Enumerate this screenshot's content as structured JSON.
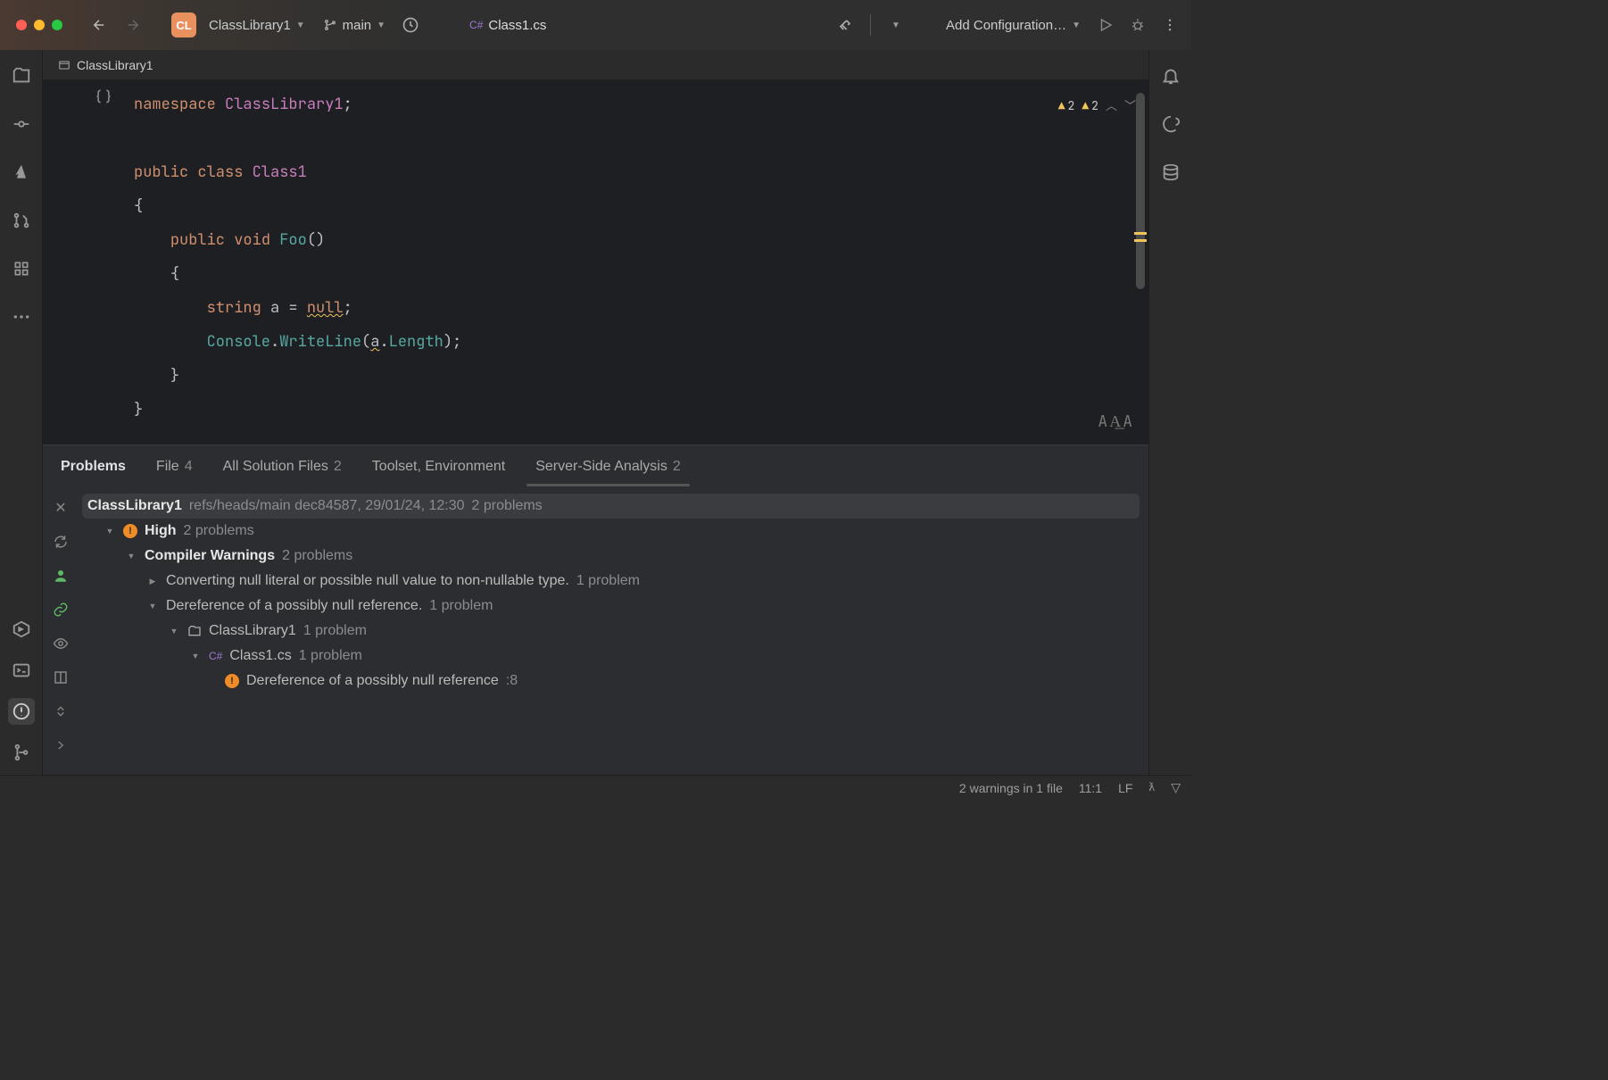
{
  "toolbar": {
    "project_badge": "CL",
    "project_name": "ClassLibrary1",
    "branch": "main",
    "open_file": "Class1.cs",
    "run_config": "Add Configuration…"
  },
  "breadcrumb": {
    "root": "ClassLibrary1"
  },
  "editor": {
    "warnings_a": "2",
    "warnings_b": "2",
    "code": {
      "namespace_kw": "namespace",
      "namespace_name": "ClassLibrary1",
      "semi": ";",
      "public_kw": "public",
      "class_kw": "class",
      "class_name": "Class1",
      "lbrace": "{",
      "void_kw": "void",
      "method_name": "Foo",
      "parens": "()",
      "string_kw": "string",
      "var_a": "a",
      "eq": "=",
      "null_kw": "null",
      "console": "Console",
      "dot": ".",
      "writeline": "WriteLine",
      "open_p": "(",
      "length": "Length",
      "close_p": ")",
      "rbrace": "}"
    }
  },
  "problems": {
    "title": "Problems",
    "tabs": [
      {
        "label": "File",
        "count": "4"
      },
      {
        "label": "All Solution Files",
        "count": "2"
      },
      {
        "label": "Toolset, Environment",
        "count": ""
      },
      {
        "label": "Server-Side Analysis",
        "count": "2"
      }
    ],
    "header": {
      "project": "ClassLibrary1",
      "meta": "refs/heads/main dec84587, 29/01/24, 12:30",
      "summary": "2 problems"
    },
    "tree": {
      "high_label": "High",
      "high_count": "2 problems",
      "compiler_label": "Compiler Warnings",
      "compiler_count": "2 problems",
      "warn1": "Converting null literal or possible null value to non-nullable type.",
      "warn1_count": "1 problem",
      "warn2": "Dereference of a possibly null reference.",
      "warn2_count": "1 problem",
      "folder": "ClassLibrary1",
      "folder_count": "1 problem",
      "file": "Class1.cs",
      "file_count": "1 problem",
      "leaf": "Dereference of a possibly null reference",
      "leaf_loc": ":8"
    }
  },
  "status": {
    "warnings": "2 warnings in 1 file",
    "caret": "11:1",
    "eol": "LF"
  }
}
